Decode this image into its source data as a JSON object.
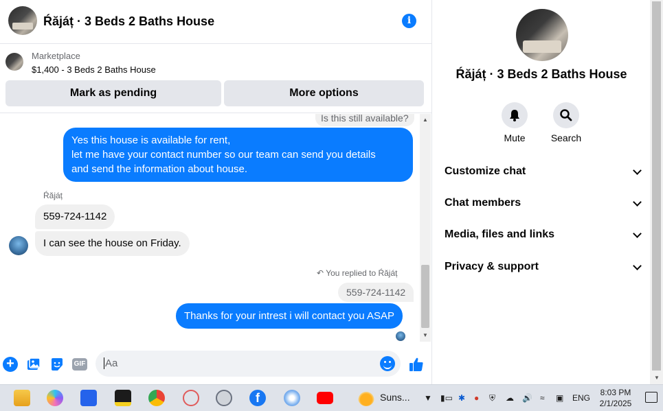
{
  "chat": {
    "title": "Ŕăjáț · 3 Beds 2 Baths House",
    "info_icon": "info-icon"
  },
  "marketplace": {
    "label": "Marketplace",
    "item": "$1,400 - 3 Beds 2 Baths House",
    "mark_pending_label": "Mark as pending",
    "more_options_label": "More options"
  },
  "thread": {
    "quoted_top": "Is this still available?",
    "outgoing_1": "Yes this house is  available for rent,\n let me have your contact number so our team can send you details\nand send the information about house.",
    "sender_name": "Ŕăjáț",
    "incoming_1": "559-724-1142",
    "incoming_2": "I can see the house on Friday.",
    "reply_meta": "You replied to Ŕăjáț",
    "reply_quote": "559-724-1142",
    "outgoing_2": "Thanks for your intrest i will contact you ASAP"
  },
  "composer": {
    "placeholder": "Aa",
    "icons": [
      "plus-icon",
      "photo-icon",
      "sticker-icon",
      "gif-icon",
      "emoji-icon",
      "like-icon"
    ],
    "gif_label": "GIF"
  },
  "sidebar": {
    "title": "Ŕăjáț · 3 Beds 2 Baths House",
    "actions": [
      {
        "label": "Mute",
        "icon": "bell-icon"
      },
      {
        "label": "Search",
        "icon": "search-icon"
      }
    ],
    "sections": [
      {
        "label": "Customize chat"
      },
      {
        "label": "Chat members"
      },
      {
        "label": "Media, files and links"
      },
      {
        "label": "Privacy & support"
      }
    ]
  },
  "taskbar": {
    "weather_label": "Suns...",
    "language": "ENG",
    "time": "8:03 PM",
    "date": "2/1/2025"
  },
  "colors": {
    "accent": "#0a7cff",
    "bubble_in": "#f0f0f0",
    "button_bg": "#e4e6eb"
  }
}
